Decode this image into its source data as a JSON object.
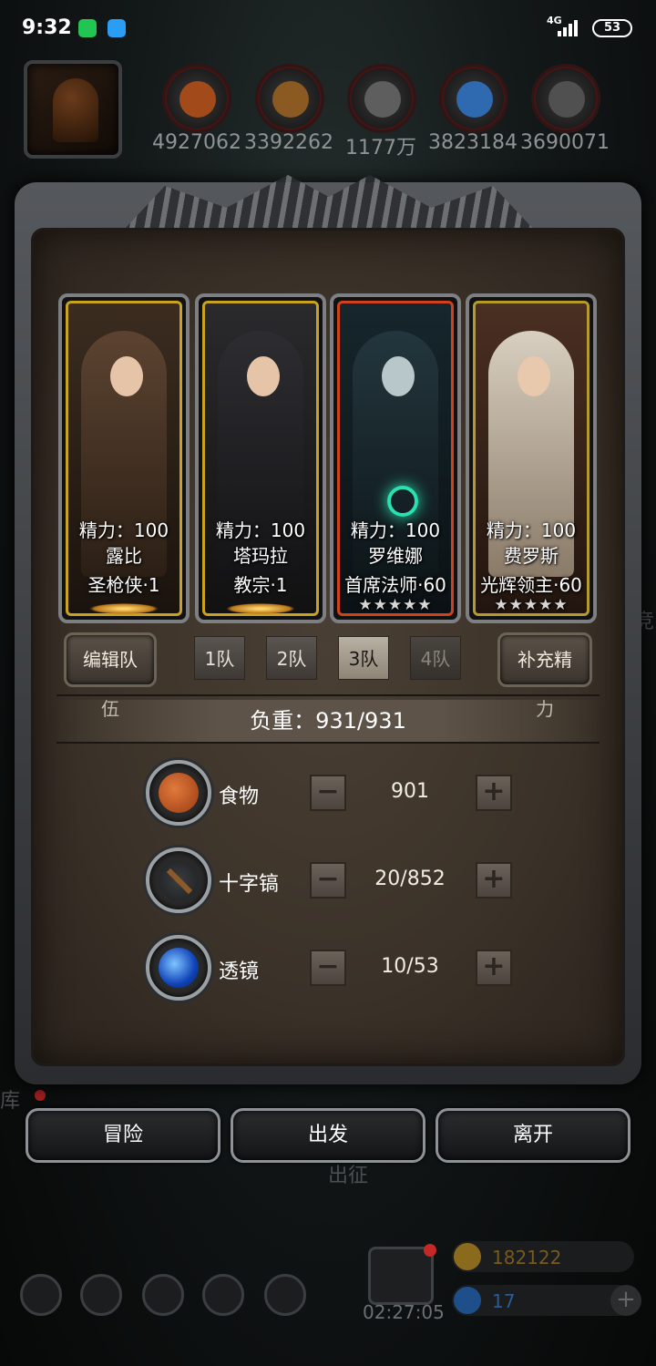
{
  "status_bar": {
    "time": "9:32",
    "network": "4G",
    "battery": "53"
  },
  "resources": [
    {
      "icon": "food-icon",
      "value": "4927062",
      "color": "#c0581f"
    },
    {
      "icon": "wood-icon",
      "value": "3392262",
      "color": "#a06a2c"
    },
    {
      "icon": "iron-icon",
      "value": "1177万",
      "color": "#7a7a7a"
    },
    {
      "icon": "crystal-icon",
      "value": "3823184",
      "color": "#3a7fd1"
    },
    {
      "icon": "stone-icon",
      "value": "3690071",
      "color": "#6b6b6b"
    }
  ],
  "heroes": [
    {
      "energy": "精力：100",
      "name": "露比",
      "class": "圣枪侠·1",
      "stars": "",
      "frame": "gold"
    },
    {
      "energy": "精力：100",
      "name": "塔玛拉",
      "class": "教宗·1",
      "stars": "",
      "frame": "gold"
    },
    {
      "energy": "精力：100",
      "name": "罗维娜",
      "class": "首席法师·60",
      "stars": "★★★★★",
      "frame": "red"
    },
    {
      "energy": "精力：100",
      "name": "费罗斯",
      "class": "光辉领主·60",
      "stars": "★★★★★",
      "frame": "gold"
    }
  ],
  "controls": {
    "edit_team": "编辑队伍",
    "teams": [
      "1队",
      "2队",
      "3队",
      "4队"
    ],
    "active_team": "3队",
    "refill_energy": "补充精力"
  },
  "load": {
    "text": "负重：931/931"
  },
  "items": [
    {
      "icon": "food-icon",
      "label": "食物",
      "value": "901"
    },
    {
      "icon": "pickaxe-icon",
      "label": "十字镐",
      "value": "20/852"
    },
    {
      "icon": "lens-icon",
      "label": "透镜",
      "value": "10/53"
    }
  ],
  "actions": {
    "adventure": "冒险",
    "depart": "出发",
    "leave": "离开"
  },
  "background_hud": {
    "left_label": "库",
    "expedition": "出征",
    "timer": "02:27:05",
    "gold": "182122",
    "gems": "17",
    "right_edge": "竞"
  },
  "colors": {
    "gold_frame": "#c9a21f",
    "red_frame": "#d2421a",
    "panel_bg": "#3a3128"
  }
}
